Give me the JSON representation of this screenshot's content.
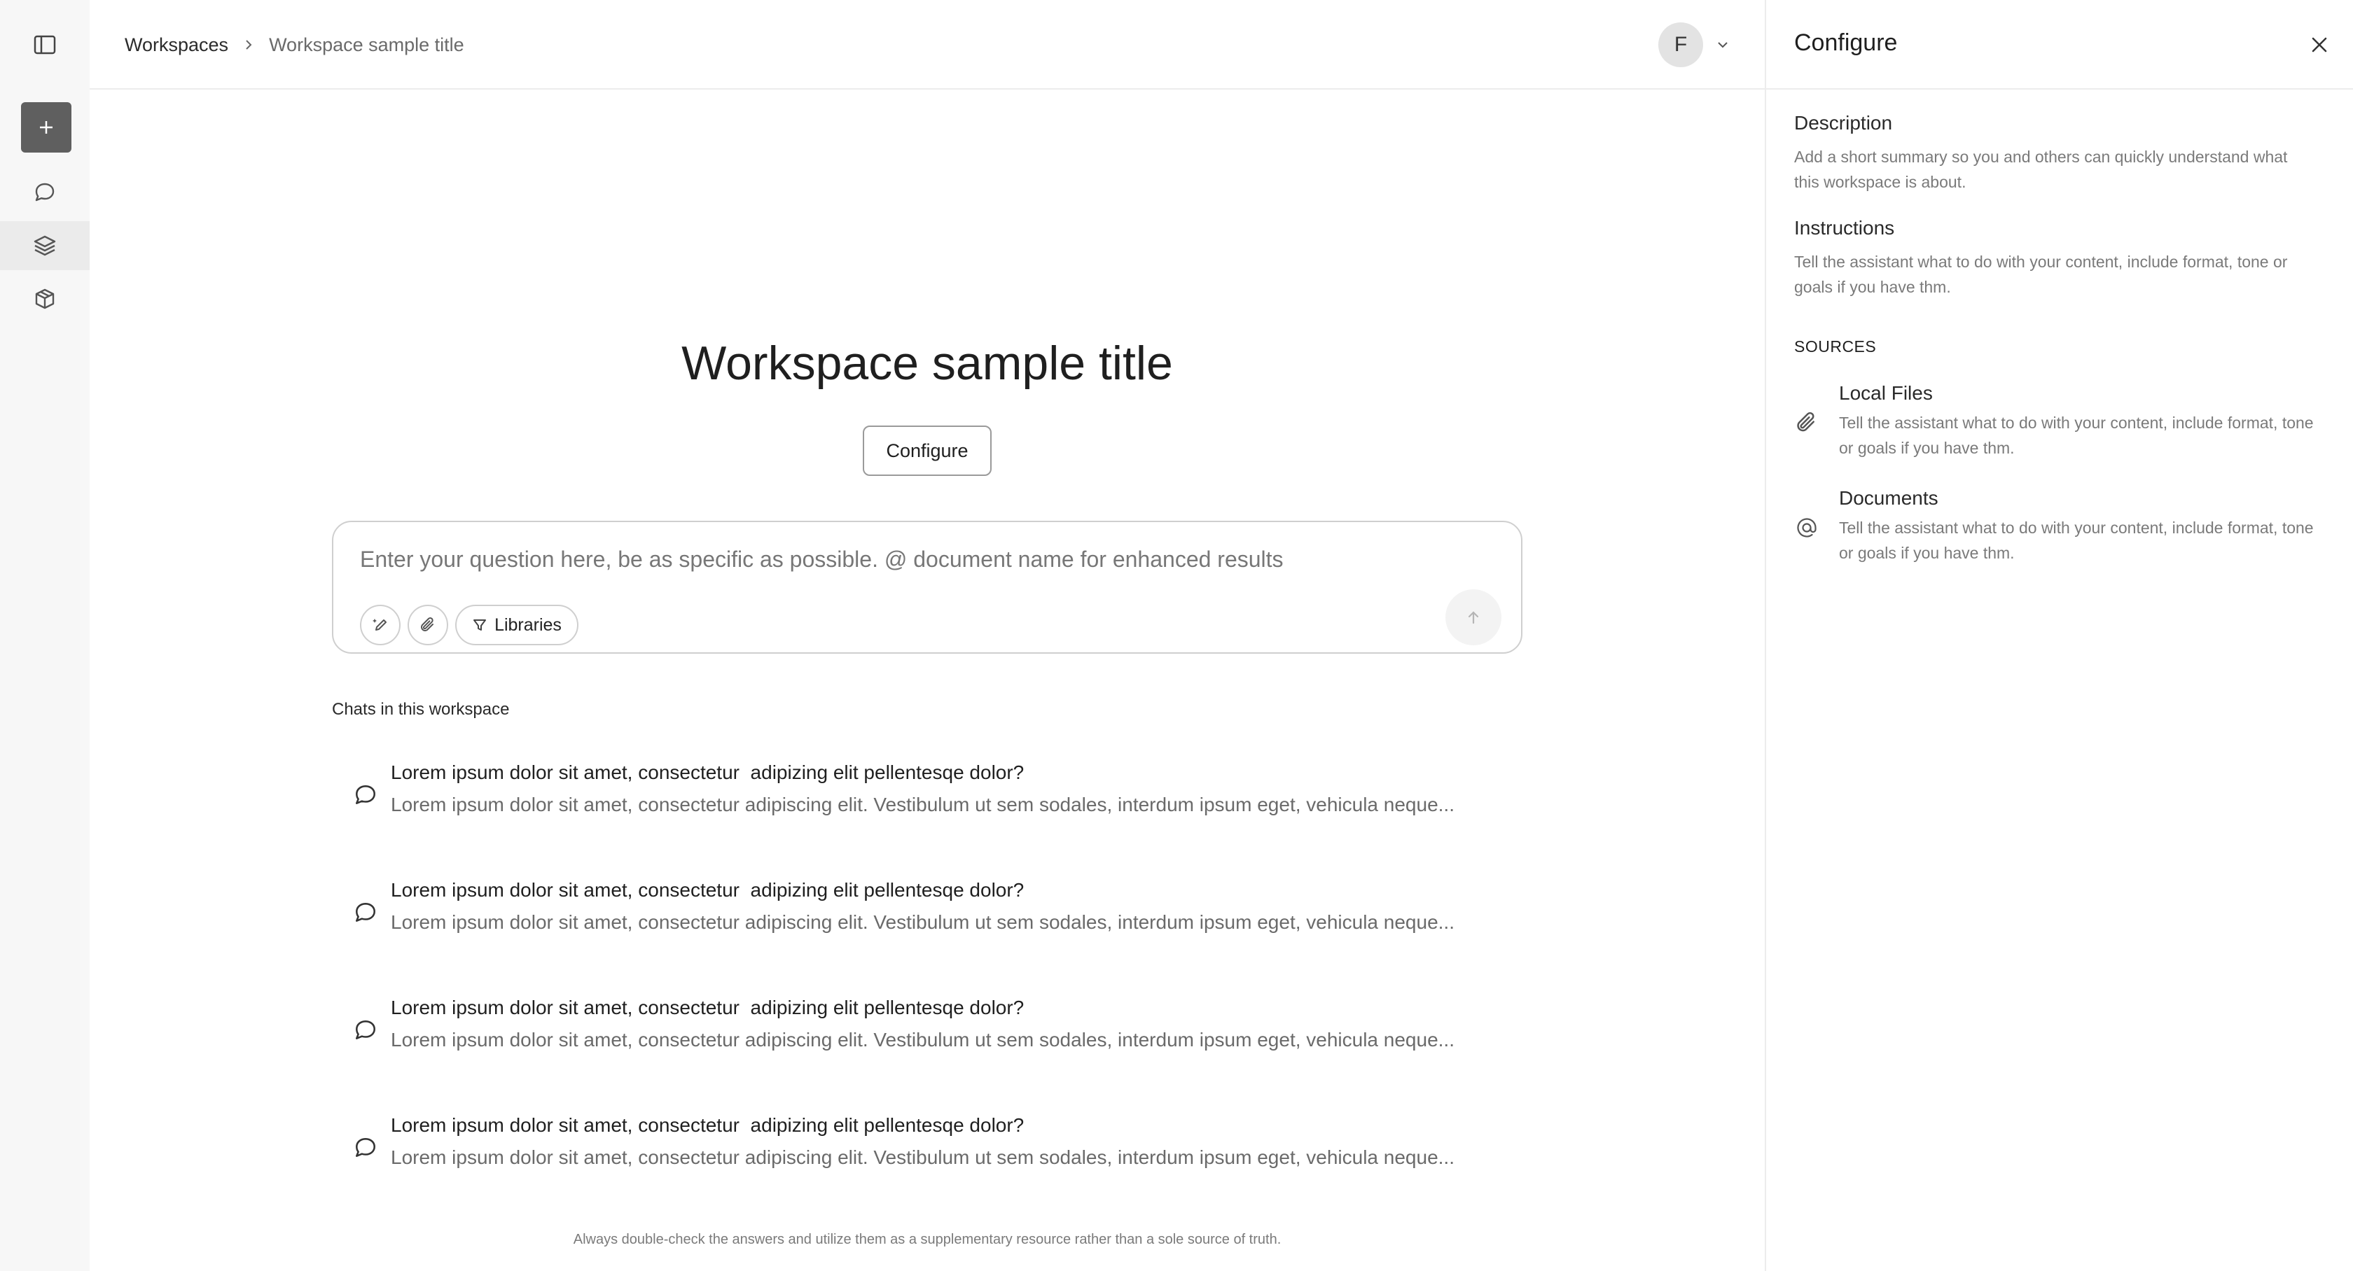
{
  "rail": {
    "toggle_icon": "sidebar-toggle-icon",
    "new_icon": "plus-icon",
    "items": [
      {
        "icon": "chat-bubble-icon",
        "name": "chats"
      },
      {
        "icon": "layers-icon",
        "name": "workspaces",
        "active": true
      },
      {
        "icon": "cube-icon",
        "name": "apps"
      }
    ]
  },
  "breadcrumb": {
    "root": "Workspaces",
    "separator_icon": "chevron-right-icon",
    "current": "Workspace sample title"
  },
  "user": {
    "initial": "F",
    "menu_icon": "chevron-down-icon"
  },
  "main": {
    "title": "Workspace sample title",
    "configure_label": "Configure",
    "composer": {
      "placeholder": "Enter your question here, be as specific as possible. @ document name for enhanced results",
      "libraries_label": "Libraries"
    },
    "chats_heading": "Chats in this workspace",
    "chats": [
      {
        "title": "Lorem ipsum dolor sit amet, consectetur  adipizing elit pellentesqe dolor?",
        "preview": "Lorem ipsum dolor sit amet, consectetur adipiscing elit. Vestibulum ut sem sodales, interdum ipsum eget, vehicula neque..."
      },
      {
        "title": "Lorem ipsum dolor sit amet, consectetur  adipizing elit pellentesqe dolor?",
        "preview": "Lorem ipsum dolor sit amet, consectetur adipiscing elit. Vestibulum ut sem sodales, interdum ipsum eget, vehicula neque..."
      },
      {
        "title": "Lorem ipsum dolor sit amet, consectetur  adipizing elit pellentesqe dolor?",
        "preview": "Lorem ipsum dolor sit amet, consectetur adipiscing elit. Vestibulum ut sem sodales, interdum ipsum eget, vehicula neque..."
      },
      {
        "title": "Lorem ipsum dolor sit amet, consectetur  adipizing elit pellentesqe dolor?",
        "preview": "Lorem ipsum dolor sit amet, consectetur adipiscing elit. Vestibulum ut sem sodales, interdum ipsum eget, vehicula neque..."
      }
    ],
    "disclaimer": "Always double-check the answers and utilize them as a supplementary resource rather than a sole source of truth."
  },
  "panel": {
    "title": "Configure",
    "description_label": "Description",
    "description_text": "Add a short summary so you and others can quickly understand what this workspace is about.",
    "instructions_label": "Instructions",
    "instructions_text": "Tell the assistant what to do with your content, include format, tone or goals if you have thm.",
    "sources_label": "SOURCES",
    "sources": [
      {
        "icon": "paperclip-icon",
        "title": "Local Files",
        "text": "Tell the assistant what to do with your content, include format, tone or goals if you have thm."
      },
      {
        "icon": "at-sign-icon",
        "title": "Documents",
        "text": "Tell the assistant what to do with your content, include format, tone or goals if you have thm."
      }
    ]
  },
  "colors": {
    "rail_bg": "#f7f7f7",
    "active_item_bg": "#ebebeb",
    "new_button_bg": "#5f5f5f",
    "border": "#ececec",
    "muted_text": "#7a7a7a"
  }
}
